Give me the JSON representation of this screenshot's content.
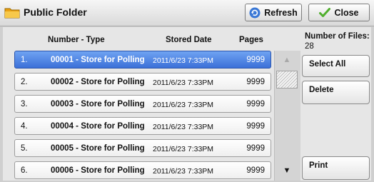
{
  "header": {
    "title": "Public Folder",
    "refresh_label": "Refresh",
    "close_label": "Close",
    "colors": {
      "refresh_icon": "#3a78d6",
      "close_check": "#4fae2c",
      "folder": "#f3b31c"
    }
  },
  "columns": {
    "number_type": "Number - Type",
    "stored_date": "Stored Date",
    "pages": "Pages"
  },
  "files": {
    "label": "Number of Files:",
    "count": "28"
  },
  "rows": [
    {
      "index": "1.",
      "name": "00001 - Store for Polling",
      "date": "2011/6/23 7:33PM",
      "pages": "9999",
      "selected": true
    },
    {
      "index": "2.",
      "name": "00002 - Store for Polling",
      "date": "2011/6/23 7:33PM",
      "pages": "9999",
      "selected": false
    },
    {
      "index": "3.",
      "name": "00003 - Store for Polling",
      "date": "2011/6/23 7:33PM",
      "pages": "9999",
      "selected": false
    },
    {
      "index": "4.",
      "name": "00004 - Store for Polling",
      "date": "2011/6/23 7:33PM",
      "pages": "9999",
      "selected": false
    },
    {
      "index": "5.",
      "name": "00005 - Store for Polling",
      "date": "2011/6/23 7:33PM",
      "pages": "9999",
      "selected": false
    },
    {
      "index": "6.",
      "name": "00006 - Store for Polling",
      "date": "2011/6/23 7:33PM",
      "pages": "9999",
      "selected": false
    }
  ],
  "scroll": {
    "up_icon": "up-arrow",
    "down_icon": "down-arrow",
    "up": "▲",
    "down": "▼"
  },
  "actions": {
    "select_all": "Select All",
    "delete": "Delete",
    "print": "Print"
  }
}
